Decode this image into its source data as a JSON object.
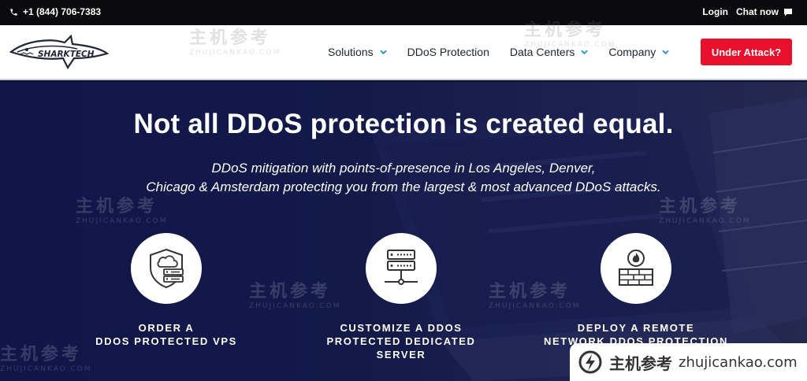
{
  "topbar": {
    "phone": "+1 (844) 706-7383",
    "login": "Login",
    "chat": "Chat now"
  },
  "logo": {
    "text": "SHARKTECH"
  },
  "nav": {
    "items": [
      {
        "label": "Solutions",
        "dropdown": true
      },
      {
        "label": "DDoS Protection",
        "dropdown": false
      },
      {
        "label": "Data Centers",
        "dropdown": true
      },
      {
        "label": "Company",
        "dropdown": true
      }
    ],
    "cta": "Under Attack?"
  },
  "hero": {
    "headline": "Not all DDoS protection is created equal.",
    "sub_line1": "DDoS mitigation with points-of-presence in Los Angeles, Denver,",
    "sub_line2": "Chicago & Amsterdam protecting you from the largest & most advanced DDoS attacks."
  },
  "features": [
    {
      "icon": "cloud-shield-server-icon",
      "line1": "ORDER A",
      "line2": "DDOS PROTECTED VPS",
      "line3": ""
    },
    {
      "icon": "server-rack-icon",
      "line1": "CUSTOMIZE A DDOS",
      "line2": "PROTECTED DEDICATED",
      "line3": "SERVER"
    },
    {
      "icon": "firewall-icon",
      "line1": "DEPLOY A REMOTE",
      "line2": "NETWORK DDOS PROTECTION",
      "line3": ""
    }
  ],
  "watermark": {
    "cn": "主机参考",
    "url": "zhujicankao.com",
    "faint_cn": "主机参考",
    "faint_url": "ZHUJICANKAO.COM"
  },
  "colors": {
    "cta": "#e8102c",
    "chevron": "#1f8fd6",
    "hero_bg": "#131a4a"
  }
}
